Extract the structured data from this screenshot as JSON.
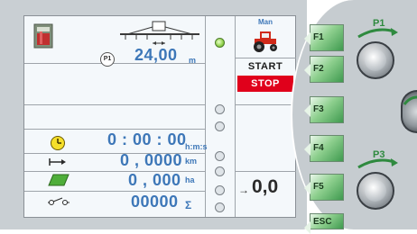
{
  "mode": {
    "manual_label": "Man"
  },
  "speed": {
    "value": "24,00",
    "unit": "m",
    "badge": "P1"
  },
  "controls": {
    "start_label": "START",
    "stop_label": "STOP"
  },
  "time": {
    "value": "0 : 00 : 00",
    "unit": "h:m:s"
  },
  "distance": {
    "value": "0 , 0000",
    "unit": "km"
  },
  "area": {
    "value": "0 , 000",
    "unit": "ha"
  },
  "counter": {
    "value": "00000",
    "unit": "Σ"
  },
  "reading": {
    "value": "0,0",
    "arrow": "→"
  },
  "function_keys": [
    "F1",
    "F2",
    "F3",
    "F4",
    "F5"
  ],
  "esc_label": "ESC",
  "knobs": {
    "p1_label": "P1",
    "p3_label": "P3"
  },
  "colors": {
    "accent_blue": "#3d77b8",
    "stop_red": "#e0001b",
    "led_green": "#8fd04a",
    "key_green": "#3f9a4f"
  }
}
